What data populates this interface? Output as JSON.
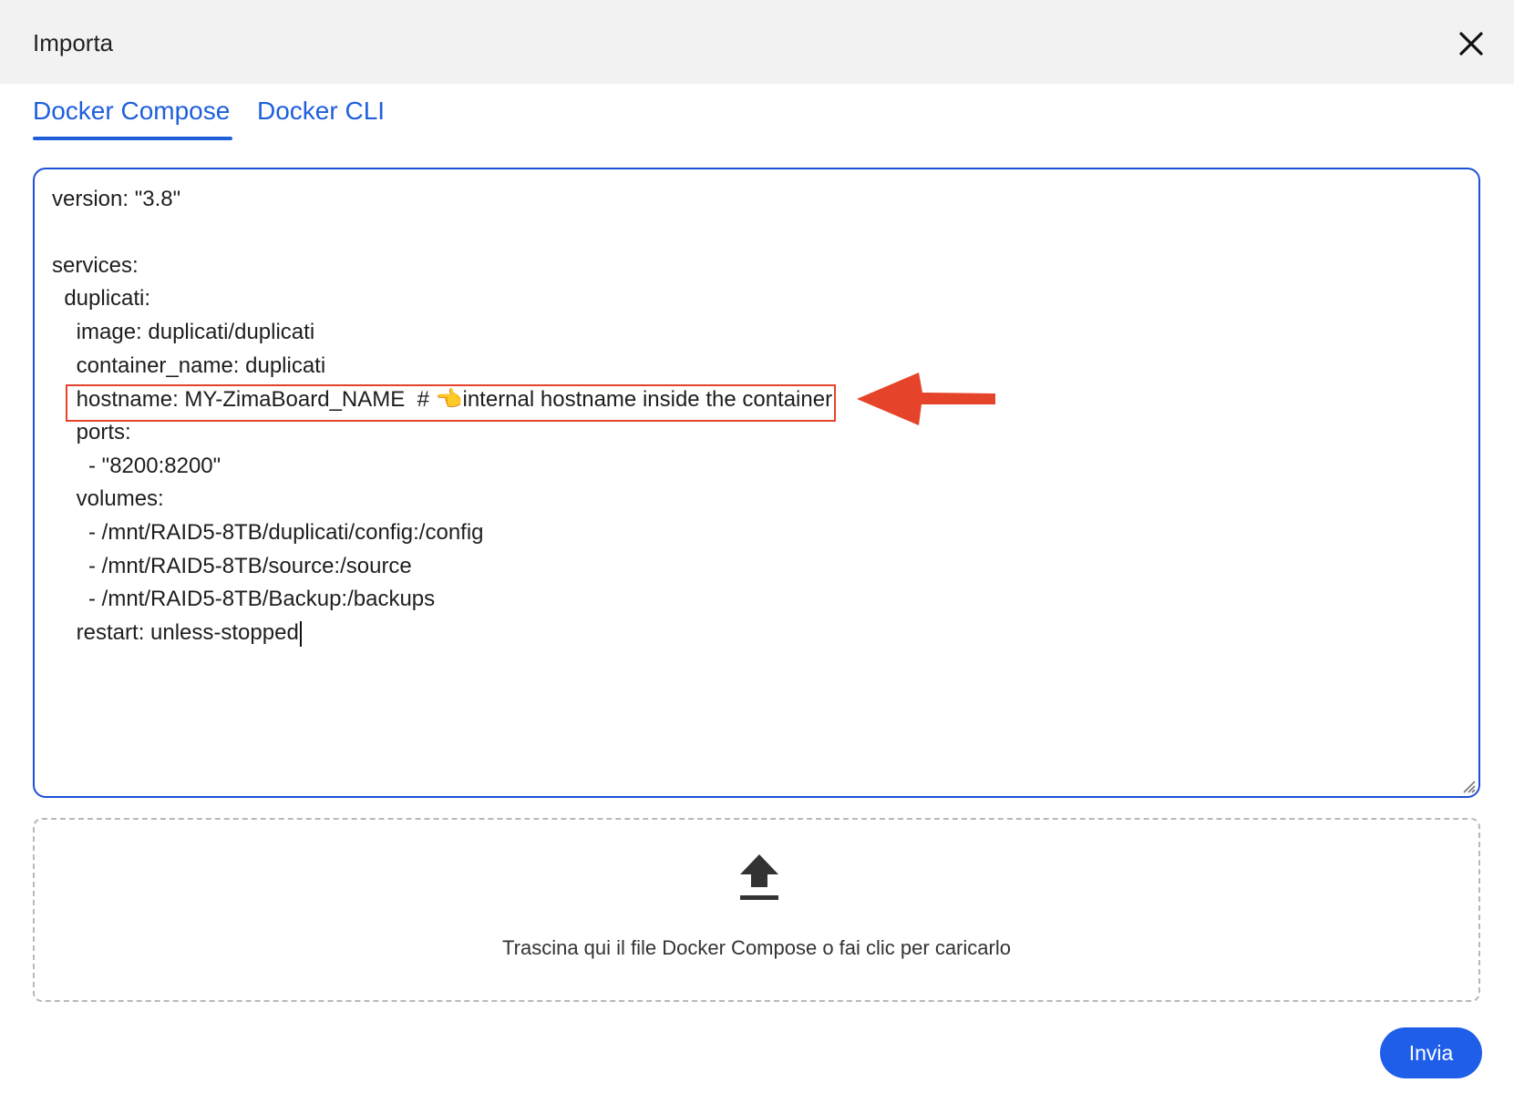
{
  "dialog": {
    "title": "Importa",
    "close_icon": "close-icon"
  },
  "tabs": [
    {
      "label": "Docker Compose",
      "active": true
    },
    {
      "label": "Docker CLI",
      "active": false
    }
  ],
  "editor": {
    "lines": [
      "version: \"3.8\"",
      "",
      "services:",
      "  duplicati:",
      "    image: duplicati/duplicati",
      "    container_name: duplicati",
      "    hostname: MY-ZimaBoard_NAME  # 👈internal hostname inside the container",
      "    ports:",
      "      - \"8200:8200\"",
      "    volumes:",
      "      - /mnt/RAID5-8TB/duplicati/config:/config",
      "      - /mnt/RAID5-8TB/source:/source",
      "      - /mnt/RAID5-8TB/Backup:/backups",
      "    restart: unless-stopped"
    ],
    "highlighted_line": 6,
    "annotation_color": "#e5442b"
  },
  "dropzone": {
    "icon": "upload-icon",
    "text": "Trascina qui il file Docker Compose o fai clic per caricarlo"
  },
  "submit": {
    "label": "Invia"
  },
  "colors": {
    "accent": "#1f5fdc",
    "button": "#1f5ee8",
    "header_bg": "#f2f2f3"
  }
}
